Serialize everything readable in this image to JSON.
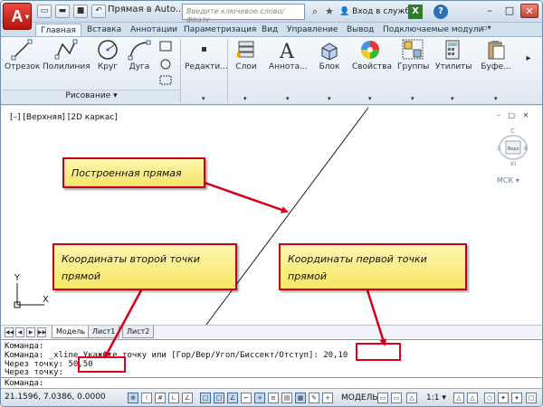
{
  "titlebar": {
    "app_letter": "A",
    "title": "Прямая в Auto...",
    "search_placeholder": "Введите ключевое слово/фразу",
    "login": "Вход в службы",
    "x_label": "X",
    "help_label": "?",
    "minimize": "–",
    "maximize": "□",
    "close": "✕"
  },
  "tabs": [
    "Главная",
    "Вставка",
    "Аннотации",
    "Параметризация",
    "Вид",
    "Управление",
    "Вывод",
    "Подключаемые модули"
  ],
  "ribbon": {
    "buttons": [
      "Отрезок",
      "Полилиния",
      "Круг",
      "Дуга",
      "Редакти...",
      "Слои",
      "Аннота...",
      "Блок",
      "Свойства",
      "Группы",
      "Утилиты",
      "Буфе..."
    ],
    "panel_draw": "Рисование",
    "dropdown": "▾"
  },
  "canvas": {
    "viewport_label": "[–] [Верхняя] [2D каркас]",
    "window_controls": "– □ ✕",
    "viewcube_top": "С",
    "viewcube_face": "Верх",
    "viewcube_south": "Ю",
    "viewcube_west": "З",
    "viewcube_east": "В",
    "wcs": "МСК ▾",
    "ucs_y": "Y",
    "ucs_x": "X",
    "line_color": "#222222"
  },
  "layout_tabs": [
    "Модель",
    "Лист1",
    "Лист2"
  ],
  "callouts": {
    "built_line": "Построенная прямая",
    "second_point": "Координаты второй точки прямой",
    "first_point": "Координаты первой точки прямой"
  },
  "cmdline": {
    "line1": "Команда:",
    "line2": "Команда: _xline Укажите точку или [Гор/Вер/Угол/Биссект/Отступ]: 20,10",
    "line3": "Через точку: 50,50",
    "line4": "Через точку:",
    "prompt": "Команда:"
  },
  "statusbar": {
    "coords": "21.1596, 7.0386, 0.0000",
    "model": "МОДЕЛЬ",
    "scale": "1:1 ▾"
  },
  "colors": {
    "callout_fill": "#f7e566",
    "callout_border": "#c8001a",
    "arrow": "#d4001a",
    "app_red": "#c1201a"
  }
}
